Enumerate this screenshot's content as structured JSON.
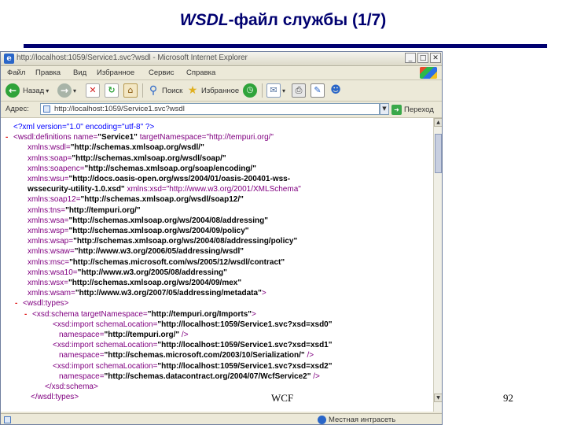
{
  "slide": {
    "title_em": "WSDL",
    "title_rest": "-файл службы  (1/7)",
    "footer_left": "WCF",
    "page_number": "92"
  },
  "browser": {
    "window_title": "http://localhost:1059/Service1.svc?wsdl - Microsoft Internet Explorer",
    "menu_items": [
      "Файл",
      "Правка",
      "Вид",
      "Избранное",
      "Сервис",
      "Справка"
    ],
    "toolbar": {
      "back_label": "Назад",
      "search_label": "Поиск",
      "favorites_label": "Избранное"
    },
    "address_label": "Адрес:",
    "address_value": "http://localhost:1059/Service1.svc?wsdl",
    "go_label": "Переход",
    "status_zone": "Местная интрасеть",
    "colors": {
      "tag": "#800080",
      "value": "#000000",
      "minus": "#e01010",
      "pi": "#0000ff"
    }
  },
  "xml_lines": [
    {
      "minus": "",
      "tag": "<?xml version=\"1.0\" encoding=\"utf-8\" ?>",
      "val": "",
      "tail": ""
    },
    {
      "minus": "-",
      "tag": "<wsdl:definitions name=",
      "val": "\"Service1\"",
      "tail": " targetNamespace=\"http://tempuri.org/\""
    },
    {
      "minus": "",
      "tag": "xmlns:wsdl=",
      "val": "\"http://schemas.xmlsoap.org/wsdl/\"",
      "tail": ""
    },
    {
      "minus": "",
      "tag": "xmlns:soap=",
      "val": "\"http://schemas.xmlsoap.org/wsdl/soap/\"",
      "tail": ""
    },
    {
      "minus": "",
      "tag": "xmlns:soapenc=",
      "val": "\"http://schemas.xmlsoap.org/soap/encoding/\"",
      "tail": ""
    },
    {
      "minus": "",
      "tag": "xmlns:wsu=",
      "val": "\"http://docs.oasis-open.org/wss/2004/01/oasis-200401-wss-",
      "tail": ""
    },
    {
      "minus": "",
      "tag": "",
      "val": "wssecurity-utility-1.0.xsd\"",
      "tail": " xmlns:xsd=\"http://www.w3.org/2001/XMLSchema\""
    },
    {
      "minus": "",
      "tag": "xmlns:soap12=",
      "val": "\"http://schemas.xmlsoap.org/wsdl/soap12/\"",
      "tail": ""
    },
    {
      "minus": "",
      "tag": "xmlns:tns=",
      "val": "\"http://tempuri.org/\"",
      "tail": ""
    },
    {
      "minus": "",
      "tag": "xmlns:wsa=",
      "val": "\"http://schemas.xmlsoap.org/ws/2004/08/addressing\"",
      "tail": ""
    },
    {
      "minus": "",
      "tag": "xmlns:wsp=",
      "val": "\"http://schemas.xmlsoap.org/ws/2004/09/policy\"",
      "tail": ""
    },
    {
      "minus": "",
      "tag": "xmlns:wsap=",
      "val": "\"http://schemas.xmlsoap.org/ws/2004/08/addressing/policy\"",
      "tail": ""
    },
    {
      "minus": "",
      "tag": "xmlns:wsaw=",
      "val": "\"http://www.w3.org/2006/05/addressing/wsdl\"",
      "tail": ""
    },
    {
      "minus": "",
      "tag": "xmlns:msc=",
      "val": "\"http://schemas.microsoft.com/ws/2005/12/wsdl/contract\"",
      "tail": ""
    },
    {
      "minus": "",
      "tag": "xmlns:wsa10=",
      "val": "\"http://www.w3.org/2005/08/addressing\"",
      "tail": ""
    },
    {
      "minus": "",
      "tag": "xmlns:wsx=",
      "val": "\"http://schemas.xmlsoap.org/ws/2004/09/mex\"",
      "tail": ""
    },
    {
      "minus": "",
      "tag": "xmlns:wsam=",
      "val": "\"http://www.w3.org/2007/05/addressing/metadata\"",
      "tail": ">"
    },
    {
      "minus": "-",
      "tag": "<wsdl:types>",
      "val": "",
      "tail": ""
    },
    {
      "minus": "-",
      "tag": "<xsd:schema targetNamespace=",
      "val": "\"http://tempuri.org/Imports\"",
      "tail": ">"
    },
    {
      "minus": "",
      "tag": "<xsd:import schemaLocation=",
      "val": "\"http://localhost:1059/Service1.svc?xsd=xsd0\"",
      "tail": ""
    },
    {
      "minus": "",
      "tag": "namespace=",
      "val": "\"http://tempuri.org/\"",
      "tail": " />"
    },
    {
      "minus": "",
      "tag": "<xsd:import schemaLocation=",
      "val": "\"http://localhost:1059/Service1.svc?xsd=xsd1\"",
      "tail": ""
    },
    {
      "minus": "",
      "tag": "namespace=",
      "val": "\"http://schemas.microsoft.com/2003/10/Serialization/\"",
      "tail": " />"
    },
    {
      "minus": "",
      "tag": "<xsd:import schemaLocation=",
      "val": "\"http://localhost:1059/Service1.svc?xsd=xsd2\"",
      "tail": ""
    },
    {
      "minus": "",
      "tag": "namespace=",
      "val": "\"http://schemas.datacontract.org/2004/07/WcfService2\"",
      "tail": " />"
    },
    {
      "minus": "",
      "tag": "</xsd:schema>",
      "val": "",
      "tail": ""
    },
    {
      "minus": "",
      "tag": "</wsdl:types>",
      "val": "",
      "tail": ""
    }
  ]
}
